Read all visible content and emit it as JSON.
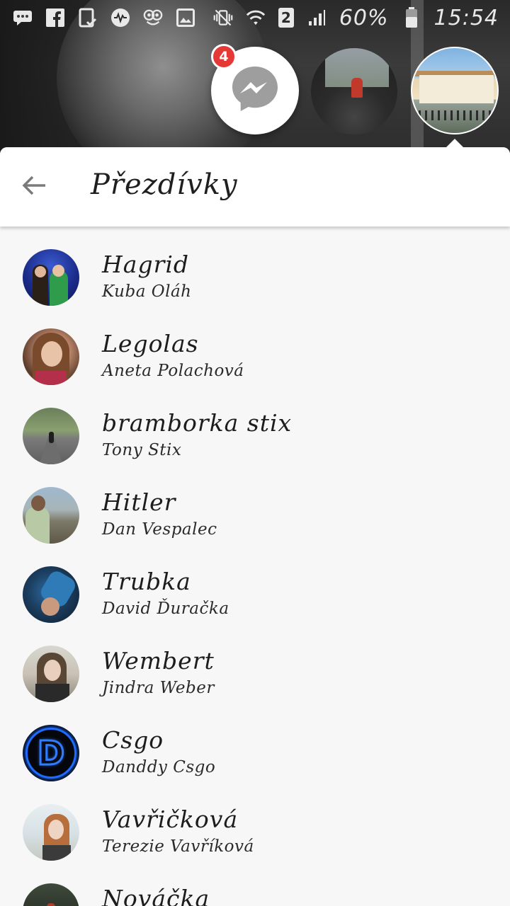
{
  "status_bar": {
    "left_icons": [
      "messages-icon",
      "facebook-icon",
      "clipboard-check-icon",
      "audio-wave-icon",
      "owl-icon",
      "gallery-icon"
    ],
    "right_icons": [
      "vibrate-icon",
      "wifi-icon",
      "sim-icon",
      "signal-icon",
      "battery-icon"
    ],
    "sim_label": "2",
    "battery_percent": "60%",
    "time": "15:54"
  },
  "chat_heads": {
    "messenger_badge_count": "4",
    "icons": [
      "messenger-icon"
    ]
  },
  "panel": {
    "title": "Přezdívky",
    "back_icon": "arrow-left-icon"
  },
  "nicknames": [
    {
      "nickname": "Hagrid",
      "name": "Kuba Oláh"
    },
    {
      "nickname": "Legolas",
      "name": "Aneta Polachová"
    },
    {
      "nickname": "bramborka stix",
      "name": "Tony Stix"
    },
    {
      "nickname": "Hitler",
      "name": "Dan Vespalec"
    },
    {
      "nickname": "Trubka",
      "name": "David Ďuračka"
    },
    {
      "nickname": "Wembert",
      "name": "Jindra Weber"
    },
    {
      "nickname": "Csgo",
      "name": "Danddy Csgo"
    },
    {
      "nickname": "Vavřičková",
      "name": "Terezie Vavříková"
    },
    {
      "nickname": "Nováčka",
      "name": ""
    }
  ],
  "colors": {
    "messenger_blue": "#0084ff",
    "badge_red": "#e53935",
    "panel_bg": "#f7f7f7",
    "header_bg": "#ffffff"
  }
}
